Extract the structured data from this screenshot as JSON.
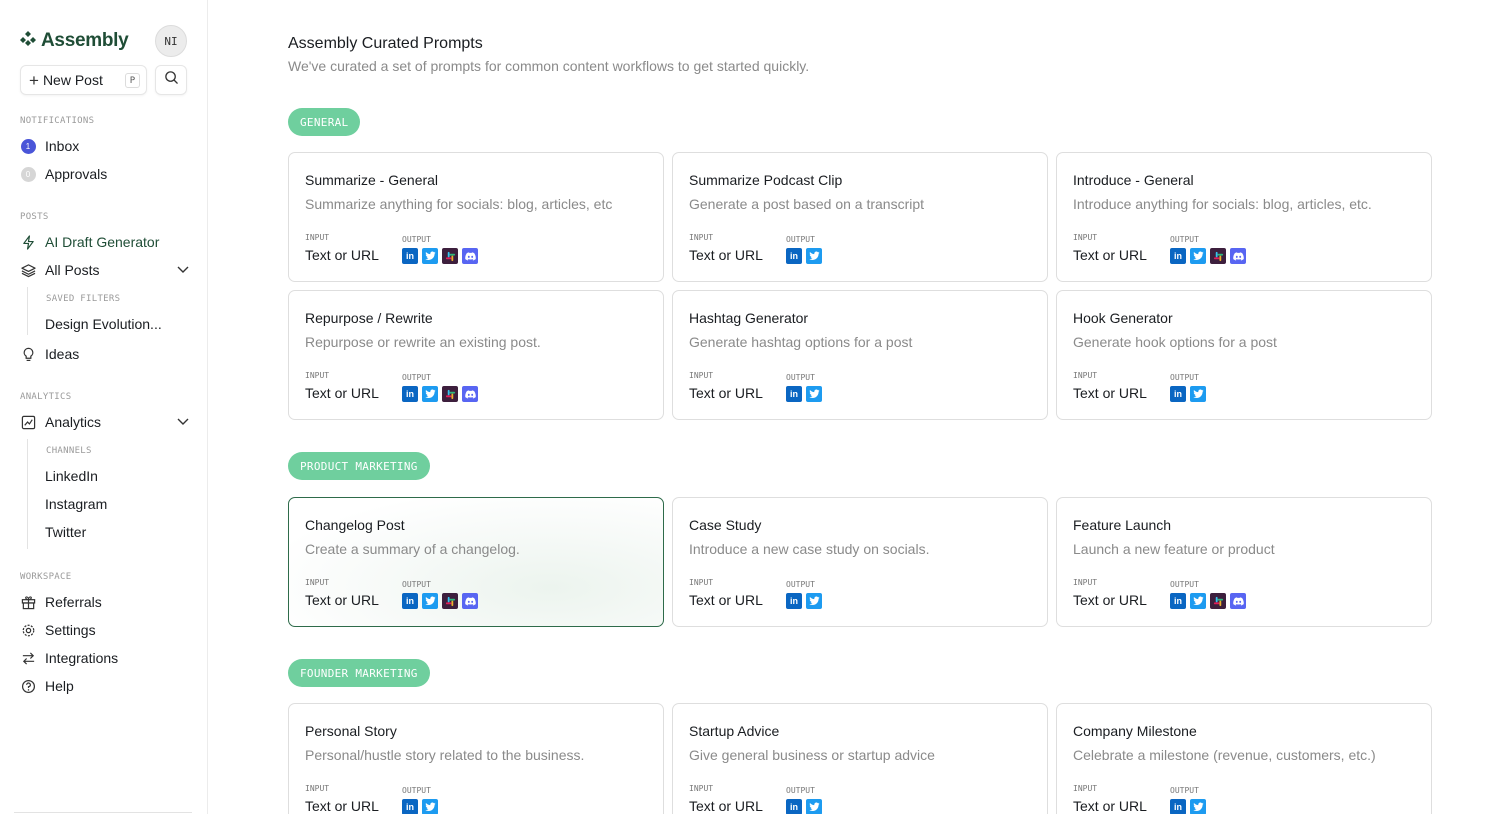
{
  "brand": {
    "name": "Assembly",
    "avatar_initials": "NI"
  },
  "toolbar": {
    "new_post_label": "New Post",
    "new_post_shortcut": "P"
  },
  "sidebar": {
    "notifications_label": "NOTIFICATIONS",
    "inbox_label": "Inbox",
    "inbox_count": "1",
    "approvals_label": "Approvals",
    "approvals_count": "0",
    "posts_label": "POSTS",
    "ai_draft_label": "AI Draft Generator",
    "all_posts_label": "All Posts",
    "saved_filters_label": "SAVED FILTERS",
    "saved_filter_item": "Design Evolution...",
    "ideas_label": "Ideas",
    "analytics_section_label": "ANALYTICS",
    "analytics_label": "Analytics",
    "channels_label": "CHANNELS",
    "channels": [
      "LinkedIn",
      "Instagram",
      "Twitter"
    ],
    "workspace_label": "WORKSPACE",
    "referrals_label": "Referrals",
    "settings_label": "Settings",
    "integrations_label": "Integrations",
    "help_label": "Help"
  },
  "page": {
    "title": "Assembly Curated Prompts",
    "subtitle": "We've curated a set of prompts for common content workflows to get started quickly.",
    "input_label": "INPUT",
    "output_label": "OUTPUT"
  },
  "sections": [
    {
      "label": "GENERAL",
      "cards": [
        {
          "title": "Summarize - General",
          "description": "Summarize anything for socials: blog, articles, etc",
          "input": "Text or URL",
          "outputs": [
            "linkedin",
            "twitter",
            "slack",
            "discord"
          ]
        },
        {
          "title": "Summarize Podcast Clip",
          "description": "Generate a post based on a transcript",
          "input": "Text or URL",
          "outputs": [
            "linkedin",
            "twitter"
          ]
        },
        {
          "title": "Introduce - General",
          "description": "Introduce anything for socials: blog, articles, etc.",
          "input": "Text or URL",
          "outputs": [
            "linkedin",
            "twitter",
            "slack",
            "discord"
          ]
        },
        {
          "title": "Repurpose / Rewrite",
          "description": "Repurpose or rewrite an existing post.",
          "input": "Text or URL",
          "outputs": [
            "linkedin",
            "twitter",
            "slack",
            "discord"
          ]
        },
        {
          "title": "Hashtag Generator",
          "description": "Generate hashtag options for a post",
          "input": "Text or URL",
          "outputs": [
            "linkedin",
            "twitter"
          ]
        },
        {
          "title": "Hook Generator",
          "description": "Generate hook options for a post",
          "input": "Text or URL",
          "outputs": [
            "linkedin",
            "twitter"
          ]
        }
      ]
    },
    {
      "label": "PRODUCT MARKETING",
      "cards": [
        {
          "title": "Changelog Post",
          "description": "Create a summary of a changelog.",
          "input": "Text or URL",
          "outputs": [
            "linkedin",
            "twitter",
            "slack",
            "discord"
          ]
        },
        {
          "title": "Case Study",
          "description": "Introduce a new case study on socials.",
          "input": "Text or URL",
          "outputs": [
            "linkedin",
            "twitter"
          ]
        },
        {
          "title": "Feature Launch",
          "description": "Launch a new feature or product",
          "input": "Text or URL",
          "outputs": [
            "linkedin",
            "twitter",
            "slack",
            "discord"
          ]
        }
      ]
    },
    {
      "label": "FOUNDER MARKETING",
      "cards": [
        {
          "title": "Personal Story",
          "description": "Personal/hustle story related to the business.",
          "input": "Text or URL",
          "outputs": [
            "linkedin",
            "twitter"
          ]
        },
        {
          "title": "Startup Advice",
          "description": "Give general business or startup advice",
          "input": "Text or URL",
          "outputs": [
            "linkedin",
            "twitter"
          ]
        },
        {
          "title": "Company Milestone",
          "description": "Celebrate a milestone (revenue, customers, etc.)",
          "input": "Text or URL",
          "outputs": [
            "linkedin",
            "twitter"
          ]
        }
      ]
    }
  ],
  "colors": {
    "brand_green": "#1f4d36",
    "pill_green": "#6fcf9e",
    "linkedin": "#0a66c2",
    "twitter": "#1d9bf0",
    "slack": "#3d1f3d",
    "discord": "#5865f2"
  }
}
